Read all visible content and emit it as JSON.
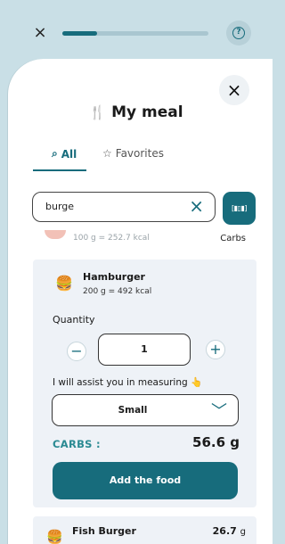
{
  "topbar": {
    "close_icon": "×",
    "help_icon": "?",
    "progress_fraction": 0.24
  },
  "sheet": {
    "close_icon": "×",
    "title_icon": "fork-knife-icon",
    "title": "My meal",
    "tabs": [
      {
        "label": "All",
        "icon": "search-icon",
        "active": true
      },
      {
        "label": "Favorites",
        "icon": "star-icon",
        "active": false
      }
    ],
    "search": {
      "value": "burge",
      "clear_icon": "×"
    },
    "barcode_icon": "barcode-icon"
  },
  "prev_item": {
    "subtitle": "100 g = 252.7 kcal",
    "tag": "Carbs"
  },
  "selected_item": {
    "name": "Hamburger",
    "serving": "200 g = 492 kcal",
    "quantity_label": "Quantity",
    "quantity": "1",
    "assist_text": "I will assist you in measuring 👆",
    "size": "Small",
    "carbs_label": "CARBS :",
    "carbs_value": "56.6 g",
    "add_button": "Add the food"
  },
  "next_item": {
    "name": "Fish Burger",
    "value": "26.7",
    "unit": "g"
  },
  "colors": {
    "accent": "#176c7c",
    "carbs_label": "#2a8a92",
    "background": "#c9dfe6"
  }
}
